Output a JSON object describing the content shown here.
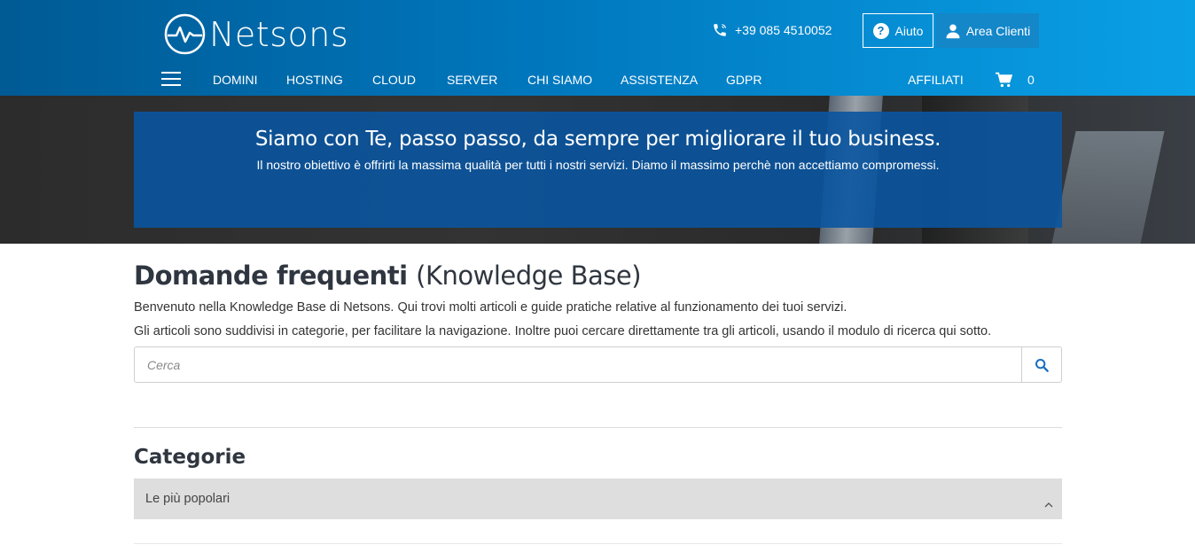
{
  "brand": {
    "name": "Netsons"
  },
  "header": {
    "phone": "+39 085 4510052",
    "help_label": "Aiuto",
    "help_icon": "question-circle-icon",
    "client_area_label": "Area Clienti",
    "client_icon": "user-icon"
  },
  "nav": {
    "items": [
      "DOMINI",
      "HOSTING",
      "CLOUD",
      "SERVER",
      "CHI SIAMO",
      "ASSISTENZA",
      "GDPR"
    ],
    "affiliates_label": "AFFILIATI",
    "cart_count": "0"
  },
  "hero": {
    "title": "Siamo con Te, passo passo, da sempre per migliorare il tuo business.",
    "subtitle": "Il nostro obiettivo è offrirti la massima qualità per tutti i nostri servizi. Diamo il massimo perchè non accettiamo compromessi."
  },
  "kb": {
    "title_bold": "Domande frequenti",
    "title_light": "(Knowledge Base)",
    "intro_line1": "Benvenuto nella Knowledge Base di Netsons. Qui trovi molti articoli e guide pratiche relative al funzionamento dei tuoi servizi.",
    "intro_line2": "Gli articoli sono suddivisi in categorie, per facilitare la navigazione. Inoltre puoi cercare direttamente tra gli articoli, usando il modulo di ricerca qui sotto.",
    "search_placeholder": "Cerca",
    "search_value": ""
  },
  "categories": {
    "title": "Categorie",
    "popular_label": "Le più popolari"
  },
  "colors": {
    "header_start": "#005a94",
    "header_end": "#0aa0e6",
    "hero_box": "#0a55a0",
    "search_icon": "#1a6fbf",
    "category_bar": "#dedede"
  }
}
